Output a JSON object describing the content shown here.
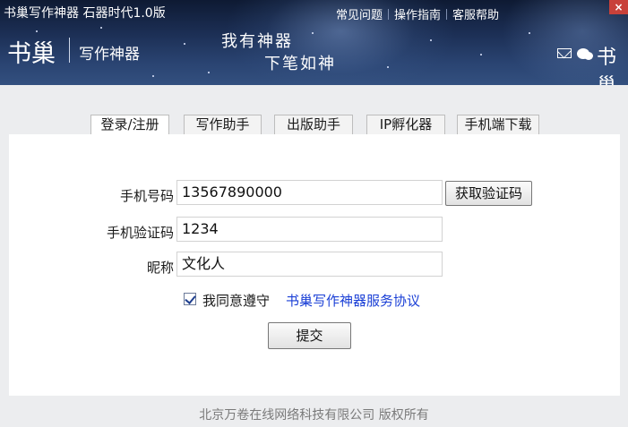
{
  "window": {
    "title": "书巢写作神器 石器时代1.0版",
    "close_glyph": "×",
    "top_menu": [
      "常见问题",
      "操作指南",
      "客服帮助"
    ]
  },
  "banner": {
    "logo_text": "书巢",
    "logo_subtitle": "写作神器",
    "slogan_line1": "我有神器",
    "slogan_line2": "下笔如神",
    "mini_logo_text": "书巢",
    "icons": [
      "mail-icon",
      "wechat-icon"
    ]
  },
  "tabs": [
    "登录/注册",
    "写作助手",
    "出版助手",
    "IP孵化器",
    "手机端下载"
  ],
  "active_tab": "登录/注册",
  "form": {
    "phone_label": "手机号码",
    "phone_value": "13567890000",
    "get_code_button": "获取验证码",
    "code_label": "手机验证码",
    "code_value": "1234",
    "nickname_label": "昵称",
    "nickname_value": "文化人",
    "agree_checked": true,
    "agree_text": "我同意遵守",
    "agreement_link": "书巢写作神器服务协议",
    "submit_button": "提交"
  },
  "footer": "北京万卷在线网络科技有限公司  版权所有",
  "colors": {
    "banner_dark": "#0e1a33",
    "banner_light": "#33507f",
    "link": "#1a3fd6",
    "close_button": "#c8413a",
    "page_background": "#ecedef"
  }
}
